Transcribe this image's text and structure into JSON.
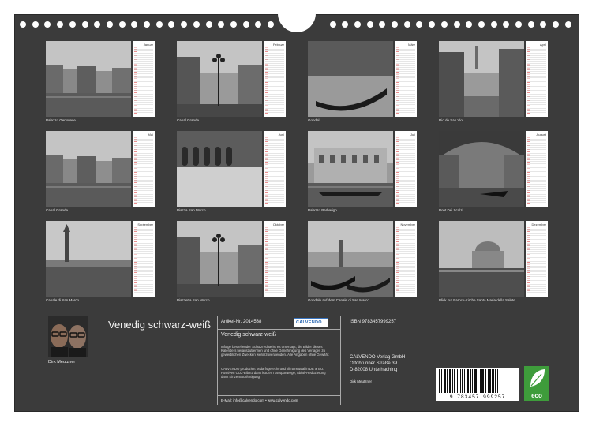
{
  "cover": {
    "title": "Venedig schwarz-weiß",
    "author": "Dirk Meutzner"
  },
  "months": [
    {
      "name": "Januar",
      "caption": "Palazzo Genovese",
      "scene": "water-buildings"
    },
    {
      "name": "Februar",
      "caption": "Canal Grande",
      "scene": "lamp-street"
    },
    {
      "name": "März",
      "caption": "Gondel",
      "scene": "gondola-close"
    },
    {
      "name": "April",
      "caption": "Rio de San Vio",
      "scene": "canal-narrow"
    },
    {
      "name": "Mai",
      "caption": "Canal Grande",
      "scene": "water-buildings"
    },
    {
      "name": "Juni",
      "caption": "Piazza San Marco",
      "scene": "arcade-reflection"
    },
    {
      "name": "Juli",
      "caption": "Palazzo Barbarigo",
      "scene": "palazzo-gondola"
    },
    {
      "name": "August",
      "caption": "Pont Dei Scalzi",
      "scene": "arch-canal"
    },
    {
      "name": "September",
      "caption": "Canale di San Marco",
      "scene": "tower-water"
    },
    {
      "name": "Oktober",
      "caption": "Piazzetta San Marco",
      "scene": "lamp-street"
    },
    {
      "name": "November",
      "caption": "Gondeln auf dem Canale di San Marco",
      "scene": "gondolas-row"
    },
    {
      "name": "Dezember",
      "caption": "Blick zur Barock-Kirche Santa Maria della Salute",
      "scene": "salute-dome"
    }
  ],
  "info": {
    "article": "Artikel-Nr. 2014538",
    "logo": "CALVENDO",
    "isbn": "ISBN 9783457999257",
    "title": "Venedig schwarz-weiß",
    "publisher_lines": [
      "CALVENDO Verlag GmbH",
      "Ottobrunner Straße 39",
      "D-82008 Unterhaching"
    ],
    "rights_text": "Infolge bestehender Schutzrechte ist es untersagt, die Bilder dieses Kalenders herauszutrennen und ohne Genehmigung des Verlages zu gewerblichen Zwecken weiterzuverwenden. Alle Angaben ohne Gewähr.",
    "climate_text": "CALVENDO produziert bedarfsgerecht und klimaneutral in DE & EU. Positiven CO2-Bilanz dank kurzer Transportwege, Abfall-Reduzierung dank Einzelstückfertigung.",
    "photographer": "Dirk Meutzner",
    "contact": "E-Mail: info@calvendo.com • www.calvendo.com",
    "barcode_digits": "9 783457 999257",
    "eco_label": "eco"
  }
}
